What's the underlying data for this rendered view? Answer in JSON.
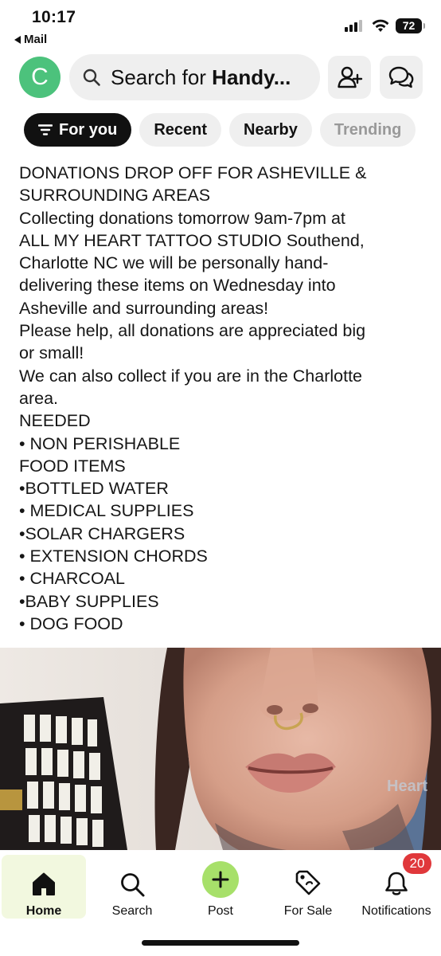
{
  "status_bar": {
    "time": "10:17",
    "back_app": "Mail",
    "battery": "72"
  },
  "header": {
    "avatar_initial": "C",
    "search_prefix": "Search for ",
    "search_term": "Handy..."
  },
  "filters": [
    "For you",
    "Recent",
    "Nearby",
    "Trending"
  ],
  "post": {
    "lines": [
      "DONATIONS DROP OFF FOR ASHEVILLE &",
      "SURROUNDING AREAS",
      "Collecting donations tomorrow 9am-7pm at",
      "ALL MY HEART TATTOO STUDIO Southend,",
      "Charlotte NC we will be personally hand-",
      "delivering these items on Wednesday into",
      "Asheville and surrounding areas!",
      "Please help, all donations are appreciated big",
      "or small!",
      "We can also collect if you are in the Charlotte",
      "area.",
      "NEEDED",
      "• NON PERISHABLE",
      "FOOD ITEMS",
      "•BOTTLED WATER",
      "• MEDICAL SUPPLIES",
      "•SOLAR CHARGERS",
      "• EXTENSION CHORDS",
      "• CHARCOAL",
      "•BABY SUPPLIES",
      "• DOG FOOD"
    ],
    "image_sign_text": "Heart"
  },
  "nav": {
    "home": "Home",
    "search": "Search",
    "post": "Post",
    "for_sale": "For Sale",
    "notifications": "Notifications",
    "notification_count": "20"
  },
  "colors": {
    "avatar": "#4cc27c",
    "active_chip": "#111111",
    "post_button": "#a7e06a",
    "badge": "#e0383b",
    "active_nav_bg": "#f2f8df"
  }
}
